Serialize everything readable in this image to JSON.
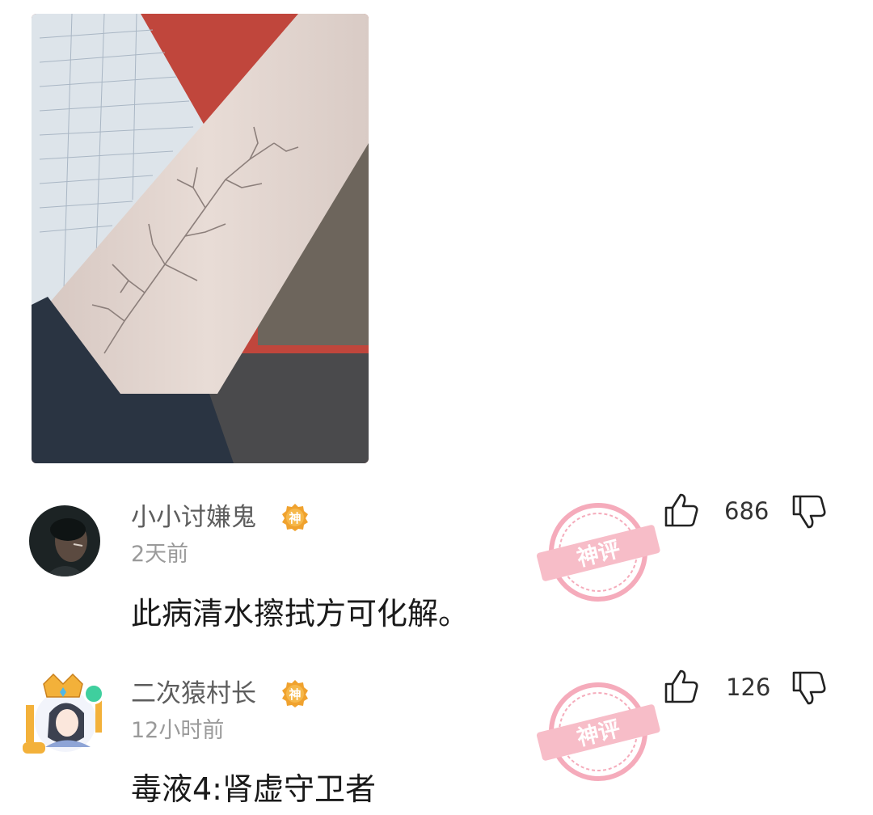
{
  "post": {
    "image_icon": "photo-arm-lightning-veins"
  },
  "comments": [
    {
      "username": "小小讨嫌鬼",
      "badge_icon": "shen-ping-badge",
      "badge_text": "神",
      "time": "2天前",
      "text": "此病清水擦拭方可化解。",
      "likes": "686",
      "stamp_text": "神评",
      "avatar_icon": "dark-portrait-avatar"
    },
    {
      "username": "二次猿村长",
      "badge_icon": "shen-ping-badge",
      "badge_text": "神",
      "time": "12小时前",
      "text": "毒液4:肾虚守卫者",
      "likes": "126",
      "stamp_text": "神评",
      "avatar_icon": "anime-girl-avatar-with-crown-frame"
    }
  ],
  "colors": {
    "badge": "#f0a22e",
    "stamp": "#f4a3b4",
    "online": "#3fcf9e"
  }
}
